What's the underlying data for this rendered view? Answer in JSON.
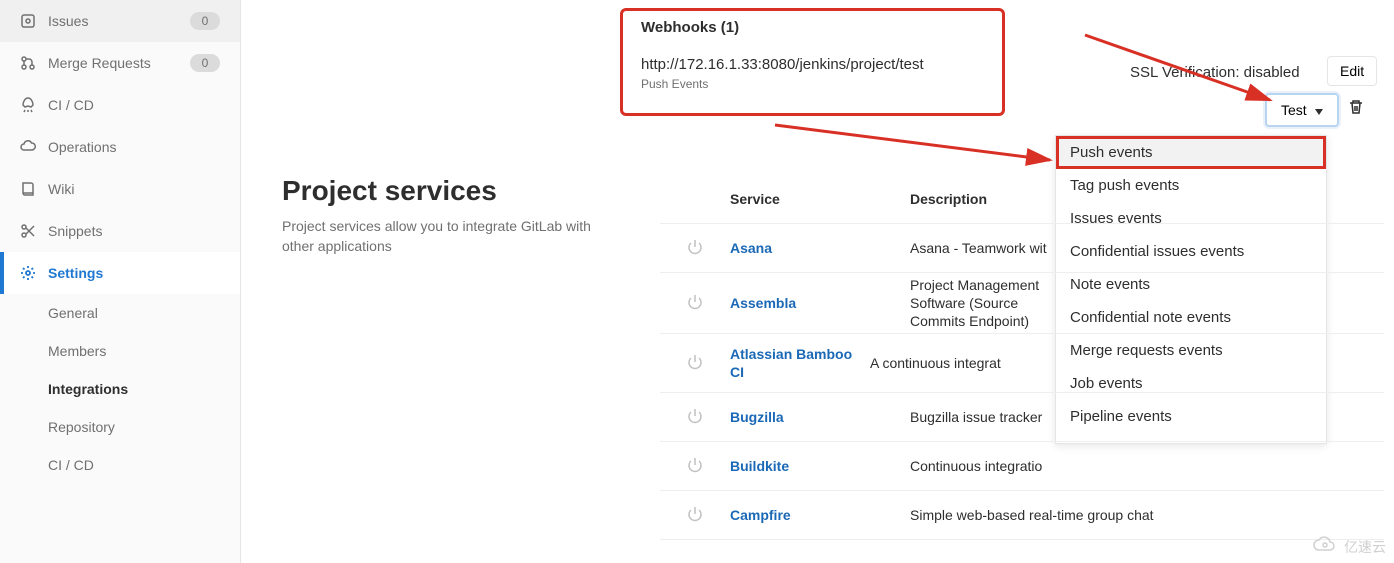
{
  "sidebar": {
    "items": [
      {
        "icon": "issues-icon",
        "label": "Issues",
        "badge": "0"
      },
      {
        "icon": "merge-icon",
        "label": "Merge Requests",
        "badge": "0"
      },
      {
        "icon": "rocket-icon",
        "label": "CI / CD"
      },
      {
        "icon": "cloud-icon",
        "label": "Operations"
      },
      {
        "icon": "book-icon",
        "label": "Wiki"
      },
      {
        "icon": "scissors-icon",
        "label": "Snippets"
      },
      {
        "icon": "gear-icon",
        "label": "Settings",
        "active": true
      }
    ],
    "settingsSub": [
      {
        "label": "General"
      },
      {
        "label": "Members"
      },
      {
        "label": "Integrations",
        "active": true
      },
      {
        "label": "Repository"
      },
      {
        "label": "CI / CD"
      }
    ]
  },
  "section": {
    "title": "Project services",
    "desc": "Project services allow you to integrate GitLab with other applications"
  },
  "webhook": {
    "title": "Webhooks (1)",
    "url": "http://172.16.1.33:8080/jenkins/project/test",
    "sub": "Push Events",
    "ssl": "SSL Verification: disabled",
    "edit": "Edit",
    "test": "Test"
  },
  "dropdown": [
    "Push events",
    "Tag push events",
    "Issues events",
    "Confidential issues events",
    "Note events",
    "Confidential note events",
    "Merge requests events",
    "Job events",
    "Pipeline events"
  ],
  "table": {
    "head": {
      "service": "Service",
      "description": "Description"
    },
    "rows": [
      {
        "name": "Asana",
        "desc": "Asana - Teamwork wit"
      },
      {
        "name": "Assembla",
        "desc": "Project Management Software (Source Commits Endpoint)"
      },
      {
        "name": "Atlassian Bamboo CI",
        "desc": "A continuous integrat"
      },
      {
        "name": "Bugzilla",
        "desc": "Bugzilla issue tracker"
      },
      {
        "name": "Buildkite",
        "desc": "Continuous integratio"
      },
      {
        "name": "Campfire",
        "desc": "Simple web-based real-time group chat"
      }
    ]
  },
  "watermark": "亿速云"
}
